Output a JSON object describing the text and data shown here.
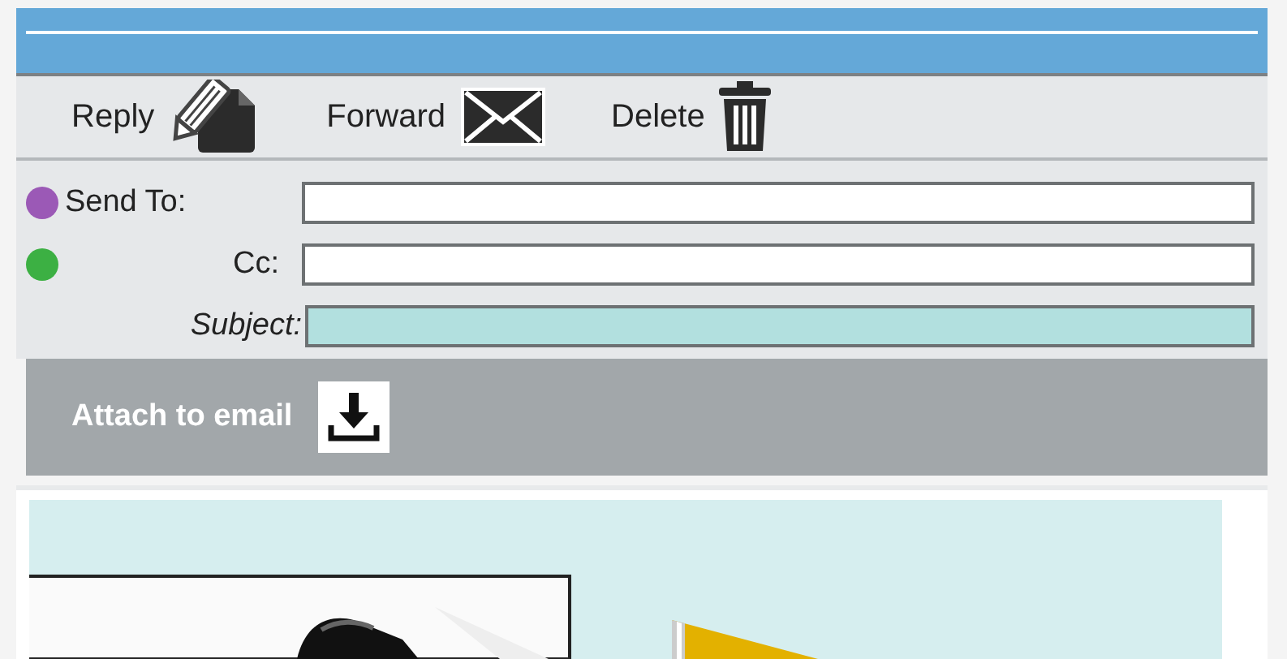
{
  "toolbar": [
    {
      "label": "Reply",
      "kind": "reply"
    },
    {
      "label": "Forward",
      "kind": "forward"
    },
    {
      "label": "Delete",
      "kind": "delete"
    }
  ],
  "fields": [
    {
      "label": "Send To:",
      "kind": "recipient",
      "color": "#9b59b6"
    },
    {
      "label": "Cc:",
      "kind": "recipient",
      "color": "#3cb043"
    },
    {
      "label": "Subject:",
      "kind": "subject"
    }
  ],
  "attach": {
    "label": "Attach to email"
  }
}
